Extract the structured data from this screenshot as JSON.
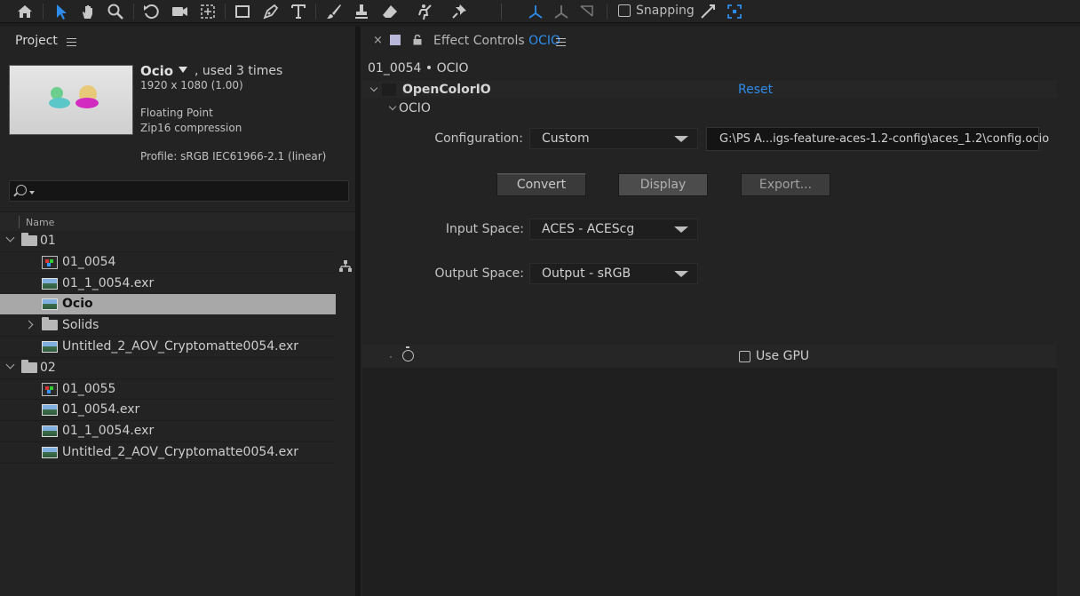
{
  "toolbar": {
    "snapping_label": "Snapping"
  },
  "project": {
    "panel_title": "Project",
    "item": {
      "name": "Ocio",
      "usage": ", used 3 times",
      "resolution": "1920 x 1080 (1.00)",
      "depth": "Floating Point",
      "compression": "Zip16 compression",
      "profile": "Profile: sRGB IEC61966-2.1 (linear)"
    },
    "column_name": "Name",
    "rows": [
      {
        "label": "01",
        "type": "folder",
        "level": 0
      },
      {
        "label": "01_0054",
        "type": "comp",
        "level": 1
      },
      {
        "label": "01_1_0054.exr",
        "type": "image",
        "level": 1
      },
      {
        "label": "Ocio",
        "type": "image",
        "level": 1,
        "selected": true
      },
      {
        "label": "Solids",
        "type": "folder",
        "level": 1
      },
      {
        "label": "Untitled_2_AOV_Cryptomatte0054.exr",
        "type": "image",
        "level": 1
      },
      {
        "label": "02",
        "type": "folder",
        "level": 0
      },
      {
        "label": "01_0055",
        "type": "comp",
        "level": 1
      },
      {
        "label": "01_0054.exr",
        "type": "image",
        "level": 1
      },
      {
        "label": "01_1_0054.exr",
        "type": "image",
        "level": 1
      },
      {
        "label": "Untitled_2_AOV_Cryptomatte0054.exr",
        "type": "image",
        "level": 1
      }
    ]
  },
  "effect_controls": {
    "tab_prefix": "Effect Controls",
    "tab_layer": "OCIO",
    "subtitle": "01_0054 • OCIO",
    "effect_name": "OpenColorIO",
    "reset_label": "Reset",
    "group_label": "OCIO",
    "configuration_label": "Configuration:",
    "configuration_value": "Custom",
    "config_path": "G:\\PS A...igs-feature-aces-1.2-config\\aces_1.2\\config.ocio",
    "buttons": {
      "convert": "Convert",
      "display": "Display",
      "export": "Export..."
    },
    "input_space_label": "Input Space:",
    "input_space_value": "ACES - ACEScg",
    "output_space_label": "Output Space:",
    "output_space_value": "Output - sRGB",
    "use_gpu_label": "Use GPU"
  },
  "colors": {
    "accent_blue": "#2d8ceb",
    "panel_bg": "#232323",
    "selected_row": "#a8a8a8"
  }
}
